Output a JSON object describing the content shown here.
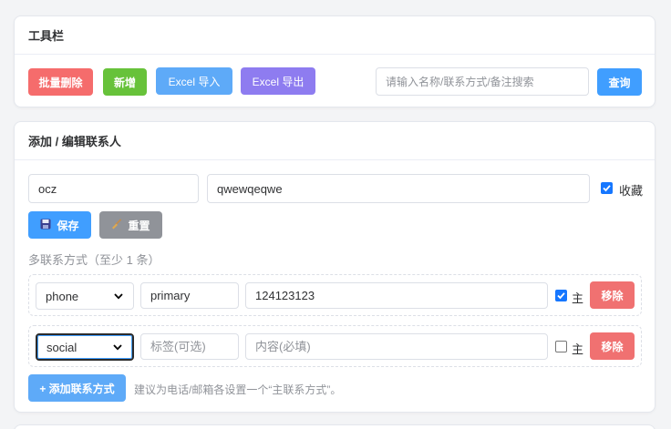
{
  "toolbar": {
    "title": "工具栏",
    "batch_delete": "批量删除",
    "add_new": "新增",
    "excel_import": "Excel 导入",
    "excel_export": "Excel 导出",
    "search_placeholder": "请输入名称/联系方式/备注搜索",
    "search_button": "查询"
  },
  "editor": {
    "title": "添加 / 编辑联系人",
    "name_value": "ocz",
    "note_value": "qwewqeqwe",
    "favorite_label": "收藏",
    "favorite_checked": true,
    "save_label": "保存",
    "reset_label": "重置",
    "methods_label": "多联系方式（至少 1 条）",
    "contacts": [
      {
        "type": "phone",
        "tag_value": "primary",
        "tag_placeholder": "标签(可选)",
        "content_value": "124123123",
        "content_placeholder": "内容(必填)",
        "primary_checked": true,
        "primary_label": "主",
        "remove_label": "移除"
      },
      {
        "type": "social",
        "tag_value": "",
        "tag_placeholder": "标签(可选)",
        "content_value": "",
        "content_placeholder": "内容(必填)",
        "primary_checked": false,
        "primary_label": "主",
        "remove_label": "移除"
      }
    ],
    "add_method_label": "+ 添加联系方式",
    "add_method_hint": "建议为电话/邮箱各设置一个“主联系方式”。"
  },
  "colors": {
    "danger": "#f56c6c",
    "success": "#67c23a",
    "primary": "#409eff",
    "purple": "#8e7cf0",
    "gray": "#909399"
  },
  "icons": {
    "save": "floppy-disk-icon",
    "reset": "broom-icon",
    "select": "chevron-down-icon",
    "checkbox": "checkmark-icon"
  }
}
